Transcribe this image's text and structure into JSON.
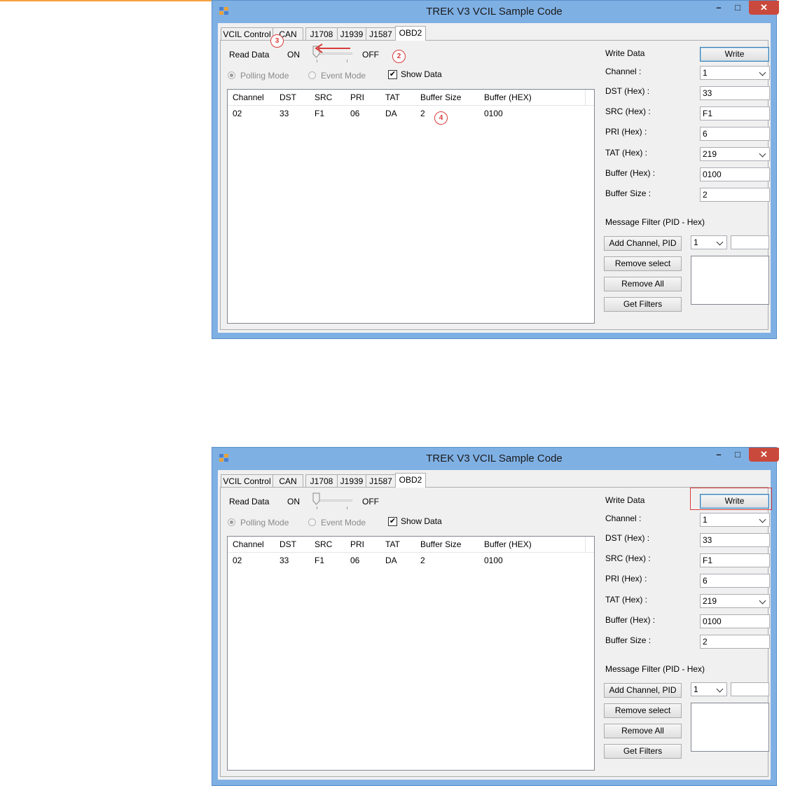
{
  "window": {
    "title": "TREK V3 VCIL Sample Code",
    "controls": {
      "minimize": "–",
      "maximize": "□",
      "close": "✕"
    }
  },
  "tabs": [
    "VCIL Control",
    "CAN",
    "J1708",
    "J1939",
    "J1587",
    "OBD2"
  ],
  "active_tab": "OBD2",
  "read": {
    "label": "Read Data",
    "on_label": "ON",
    "off_label": "OFF",
    "slider_state": "ON",
    "polling_label": "Polling Mode",
    "polling_selected": true,
    "event_label": "Event Mode",
    "show_data_label": "Show Data",
    "show_data_checked": true,
    "check_glyph": "✔"
  },
  "table": {
    "columns": [
      "Channel",
      "DST",
      "SRC",
      "PRI",
      "TAT",
      "Buffer Size",
      "Buffer (HEX)"
    ],
    "rows": [
      [
        "02",
        "33",
        "F1",
        "06",
        "DA",
        "2",
        "0100"
      ]
    ]
  },
  "write": {
    "heading": "Write Data",
    "button": "Write",
    "channel_label": "Channel :",
    "channel": "1",
    "dst_label": "DST (Hex) :",
    "dst": "33",
    "src_label": "SRC (Hex) :",
    "src": "F1",
    "pri_label": "PRI (Hex) :",
    "pri": "6",
    "tat_label": "TAT (Hex) :",
    "tat": "219",
    "buffer_label": "Buffer (Hex) :",
    "buffer": "0100",
    "buffer_size_label": "Buffer Size :",
    "buffer_size": "2"
  },
  "filter": {
    "heading": "Message Filter (PID - Hex)",
    "add_button": "Add Channel, PID",
    "remove_select_button": "Remove select",
    "remove_all_button": "Remove All",
    "get_filters_button": "Get Filters",
    "channel": "1",
    "pid": ""
  },
  "annotations": {
    "badge_2": "2",
    "badge_3": "3",
    "badge_4": "4",
    "annotation_color": "#d83b3b"
  },
  "colors": {
    "window_frame": "#7fb0e4",
    "close_button": "#c94a3c",
    "page_rule": "#f7a03c"
  }
}
